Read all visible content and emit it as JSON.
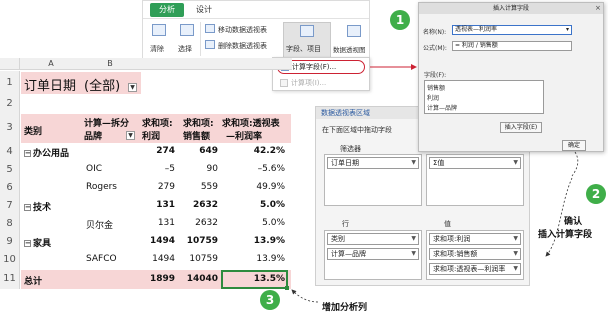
{
  "ribbon": {
    "tab_analyze": "分析",
    "tab_design": "设计",
    "clear_label": "清除",
    "select_label": "选择",
    "move_pivot_label": "移动数据透视表",
    "delete_pivot_label": "删除数据透视表",
    "fields_items_label": "字段、项目",
    "pivot_chart_label": "数据透视图"
  },
  "menu": {
    "calc_field": "计算字段(F)...",
    "calc_item": "计算项(I)..."
  },
  "sheet": {
    "col_a": "A",
    "col_b": "B",
    "filter_label": "订单日期",
    "filter_value": "(全部)",
    "headers": {
      "category": "类别",
      "sub_brand_line1": "计算—拆分",
      "sub_brand_line2": "品牌",
      "sum_profit_line1": "求和项:",
      "sum_profit_line2": "利润",
      "sum_sales_line1": "求和项:",
      "sum_sales_line2": "销售额",
      "sum_rate_line1": "求和项:透视表",
      "sum_rate_line2": "—利润率"
    },
    "row_numbers": [
      "1",
      "2",
      "3",
      "4",
      "5",
      "6",
      "7",
      "8",
      "9",
      "10",
      "11"
    ],
    "rows": [
      {
        "category": "办公用品",
        "brand": "",
        "profit": "274",
        "sales": "649",
        "rate": "42.2%"
      },
      {
        "category": "",
        "brand": "OIC",
        "profit": "–5",
        "sales": "90",
        "rate": "–5.6%"
      },
      {
        "category": "",
        "brand": "Rogers",
        "profit": "279",
        "sales": "559",
        "rate": "49.9%"
      },
      {
        "category": "技术",
        "brand": "",
        "profit": "131",
        "sales": "2632",
        "rate": "5.0%"
      },
      {
        "category": "",
        "brand": "贝尔金",
        "profit": "131",
        "sales": "2632",
        "rate": "5.0%"
      },
      {
        "category": "家具",
        "brand": "",
        "profit": "1494",
        "sales": "10759",
        "rate": "13.9%"
      },
      {
        "category": "",
        "brand": "SAFCO",
        "profit": "1494",
        "sales": "10759",
        "rate": "13.9%"
      }
    ],
    "total": {
      "label": "总计",
      "profit": "1899",
      "sales": "14040",
      "rate": "13.5%"
    }
  },
  "panel": {
    "title": "数据透视表区域",
    "hint": "在下面区域中拖动字段",
    "filter_label": "筛选器",
    "columns_label": "列",
    "rows_label": "行",
    "values_label": "值",
    "filter_field": "订单日期",
    "column_field": "Σ值",
    "row_fields": [
      "类别",
      "计算—品牌"
    ],
    "value_fields": [
      "求和项:利润",
      "求和项:销售额",
      "求和项:透视表—利润率"
    ]
  },
  "dialog": {
    "title": "插入计算字段",
    "name_label": "名称(N):",
    "name_value": "透视表—利润率",
    "formula_label": "公式(M):",
    "formula_value": "= 利润 / 销售额",
    "fields_label": "字段(F):",
    "fields": [
      "销售额",
      "利润",
      "计算—品牌"
    ],
    "insert_button": "插入字段(E)",
    "ok_button": "确定"
  },
  "callouts": {
    "step1": "1",
    "step2": "2",
    "step3": "3",
    "confirm_line1": "确认",
    "confirm_line2": "插入计算字段",
    "add_column": "增加分析列"
  },
  "colors": {
    "accent_green": "#3fae49",
    "header_pink": "#f7d6d6",
    "highlight_red": "#cc2233"
  }
}
